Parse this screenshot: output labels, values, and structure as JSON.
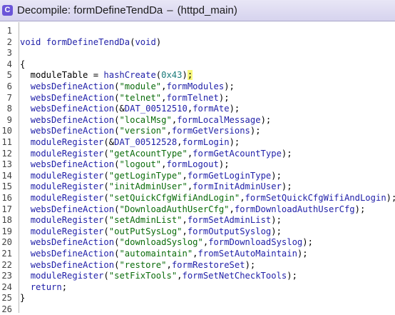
{
  "window": {
    "title": "Decompile: formDefineTendDa",
    "title_sep": "–",
    "subtitle": "(httpd_main)",
    "icon": "decompile-icon"
  },
  "lines": [
    {
      "n": "1",
      "parts": []
    },
    {
      "n": "2",
      "parts": [
        [
          "kw",
          "void"
        ],
        [
          "p",
          " "
        ],
        [
          "fn",
          "formDefineTendDa"
        ],
        [
          "p",
          "("
        ],
        [
          "kw",
          "void"
        ],
        [
          "p",
          ")"
        ]
      ]
    },
    {
      "n": "3",
      "parts": []
    },
    {
      "n": "4",
      "parts": [
        [
          "p",
          "{"
        ]
      ]
    },
    {
      "n": "5",
      "parts": [
        [
          "p",
          "  moduleTable = "
        ],
        [
          "fn",
          "hashCreate"
        ],
        [
          "p",
          "("
        ],
        [
          "num",
          "0x43"
        ],
        [
          "p",
          ")"
        ],
        [
          "hl",
          ";"
        ]
      ]
    },
    {
      "n": "6",
      "parts": [
        [
          "p",
          "  "
        ],
        [
          "fn",
          "websDefineAction"
        ],
        [
          "p",
          "("
        ],
        [
          "str",
          "\"module\""
        ],
        [
          "p",
          ","
        ],
        [
          "fn",
          "formModules"
        ],
        [
          "p",
          ");"
        ]
      ]
    },
    {
      "n": "7",
      "parts": [
        [
          "p",
          "  "
        ],
        [
          "fn",
          "websDefineAction"
        ],
        [
          "p",
          "("
        ],
        [
          "str",
          "\"telnet\""
        ],
        [
          "p",
          ","
        ],
        [
          "fn",
          "formTelnet"
        ],
        [
          "p",
          ");"
        ]
      ]
    },
    {
      "n": "8",
      "parts": [
        [
          "p",
          "  "
        ],
        [
          "fn",
          "websDefineAction"
        ],
        [
          "p",
          "(&"
        ],
        [
          "dat",
          "DAT_00512510"
        ],
        [
          "p",
          ","
        ],
        [
          "fn",
          "formAte"
        ],
        [
          "p",
          ");"
        ]
      ]
    },
    {
      "n": "9",
      "parts": [
        [
          "p",
          "  "
        ],
        [
          "fn",
          "websDefineAction"
        ],
        [
          "p",
          "("
        ],
        [
          "str",
          "\"localMsg\""
        ],
        [
          "p",
          ","
        ],
        [
          "fn",
          "formLocalMessage"
        ],
        [
          "p",
          ");"
        ]
      ]
    },
    {
      "n": "10",
      "parts": [
        [
          "p",
          "  "
        ],
        [
          "fn",
          "websDefineAction"
        ],
        [
          "p",
          "("
        ],
        [
          "str",
          "\"version\""
        ],
        [
          "p",
          ","
        ],
        [
          "fn",
          "formGetVersions"
        ],
        [
          "p",
          ");"
        ]
      ]
    },
    {
      "n": "11",
      "parts": [
        [
          "p",
          "  "
        ],
        [
          "fn",
          "moduleRegister"
        ],
        [
          "p",
          "(&"
        ],
        [
          "dat",
          "DAT_00512528"
        ],
        [
          "p",
          ","
        ],
        [
          "fn",
          "formLogin"
        ],
        [
          "p",
          ");"
        ]
      ]
    },
    {
      "n": "12",
      "parts": [
        [
          "p",
          "  "
        ],
        [
          "fn",
          "moduleRegister"
        ],
        [
          "p",
          "("
        ],
        [
          "str",
          "\"getAcountType\""
        ],
        [
          "p",
          ","
        ],
        [
          "fn",
          "formGetAcountType"
        ],
        [
          "p",
          ");"
        ]
      ]
    },
    {
      "n": "13",
      "parts": [
        [
          "p",
          "  "
        ],
        [
          "fn",
          "websDefineAction"
        ],
        [
          "p",
          "("
        ],
        [
          "str",
          "\"logout\""
        ],
        [
          "p",
          ","
        ],
        [
          "fn",
          "formLogout"
        ],
        [
          "p",
          ");"
        ]
      ]
    },
    {
      "n": "14",
      "parts": [
        [
          "p",
          "  "
        ],
        [
          "fn",
          "moduleRegister"
        ],
        [
          "p",
          "("
        ],
        [
          "str",
          "\"getLoginType\""
        ],
        [
          "p",
          ","
        ],
        [
          "fn",
          "formGetLoginType"
        ],
        [
          "p",
          ");"
        ]
      ]
    },
    {
      "n": "15",
      "parts": [
        [
          "p",
          "  "
        ],
        [
          "fn",
          "moduleRegister"
        ],
        [
          "p",
          "("
        ],
        [
          "str",
          "\"initAdminUser\""
        ],
        [
          "p",
          ","
        ],
        [
          "fn",
          "formInitAdminUser"
        ],
        [
          "p",
          ");"
        ]
      ]
    },
    {
      "n": "16",
      "parts": [
        [
          "p",
          "  "
        ],
        [
          "fn",
          "moduleRegister"
        ],
        [
          "p",
          "("
        ],
        [
          "str",
          "\"setQuickCfgWifiAndLogin\""
        ],
        [
          "p",
          ","
        ],
        [
          "fn",
          "formSetQuickCfgWifiAndLogin"
        ],
        [
          "p",
          ");"
        ]
      ]
    },
    {
      "n": "17",
      "parts": [
        [
          "p",
          "  "
        ],
        [
          "fn",
          "websDefineAction"
        ],
        [
          "p",
          "("
        ],
        [
          "str",
          "\"DownloadAuthUserCfg\""
        ],
        [
          "p",
          ","
        ],
        [
          "fn",
          "formDownloadAuthUserCfg"
        ],
        [
          "p",
          ");"
        ]
      ]
    },
    {
      "n": "18",
      "parts": [
        [
          "p",
          "  "
        ],
        [
          "fn",
          "moduleRegister"
        ],
        [
          "p",
          "("
        ],
        [
          "str",
          "\"setAdminList\""
        ],
        [
          "p",
          ","
        ],
        [
          "fn",
          "formSetAdminList"
        ],
        [
          "p",
          ");"
        ]
      ]
    },
    {
      "n": "19",
      "parts": [
        [
          "p",
          "  "
        ],
        [
          "fn",
          "moduleRegister"
        ],
        [
          "p",
          "("
        ],
        [
          "str",
          "\"outPutSysLog\""
        ],
        [
          "p",
          ","
        ],
        [
          "fn",
          "formOutputSyslog"
        ],
        [
          "p",
          ");"
        ]
      ]
    },
    {
      "n": "20",
      "parts": [
        [
          "p",
          "  "
        ],
        [
          "fn",
          "websDefineAction"
        ],
        [
          "p",
          "("
        ],
        [
          "str",
          "\"downloadSyslog\""
        ],
        [
          "p",
          ","
        ],
        [
          "fn",
          "formDownloadSyslog"
        ],
        [
          "p",
          ");"
        ]
      ]
    },
    {
      "n": "21",
      "parts": [
        [
          "p",
          "  "
        ],
        [
          "fn",
          "websDefineAction"
        ],
        [
          "p",
          "("
        ],
        [
          "str",
          "\"automaintain\""
        ],
        [
          "p",
          ","
        ],
        [
          "fn",
          "fromSetAutoMaintain"
        ],
        [
          "p",
          ");"
        ]
      ]
    },
    {
      "n": "22",
      "parts": [
        [
          "p",
          "  "
        ],
        [
          "fn",
          "websDefineAction"
        ],
        [
          "p",
          "("
        ],
        [
          "str",
          "\"restore\""
        ],
        [
          "p",
          ","
        ],
        [
          "fn",
          "formRestoreSet"
        ],
        [
          "p",
          ");"
        ]
      ]
    },
    {
      "n": "23",
      "parts": [
        [
          "p",
          "  "
        ],
        [
          "fn",
          "moduleRegister"
        ],
        [
          "p",
          "("
        ],
        [
          "str",
          "\"setFixTools\""
        ],
        [
          "p",
          ","
        ],
        [
          "fn",
          "formSetNetCheckTools"
        ],
        [
          "p",
          ");"
        ]
      ]
    },
    {
      "n": "24",
      "parts": [
        [
          "p",
          "  "
        ],
        [
          "kw",
          "return"
        ],
        [
          "p",
          ";"
        ]
      ]
    },
    {
      "n": "25",
      "parts": [
        [
          "p",
          "}"
        ]
      ]
    },
    {
      "n": "26",
      "parts": []
    }
  ]
}
